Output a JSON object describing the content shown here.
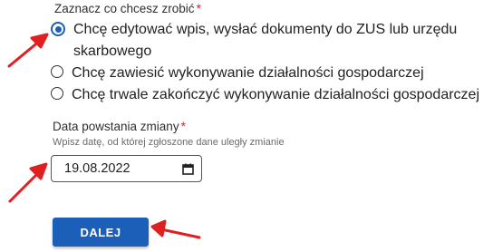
{
  "form": {
    "question_label": "Zaznacz co chcesz zrobić",
    "required_mark": "*",
    "options": [
      {
        "label": "Chcę edytować wpis, wysłać dokumenty do ZUS lub urzędu skarbowego",
        "selected": true
      },
      {
        "label": "Chcę zawiesić wykonywanie działalności gospodarczej",
        "selected": false
      },
      {
        "label": "Chcę trwale zakończyć wykonywanie działalności gospodarczej",
        "selected": false
      }
    ],
    "date_label": "Data powstania zmiany",
    "date_hint": "Wpisz datę, od której zgłoszone dane uległy zmianie",
    "date_value": "19.08.2022",
    "next_button": "DALEJ"
  },
  "colors": {
    "accent": "#1c5fb8",
    "required": "#c62828",
    "annotation_arrow": "#e02020"
  },
  "icons": {
    "date_picker": "calendar-icon",
    "annotations": "red-arrow-icon"
  }
}
